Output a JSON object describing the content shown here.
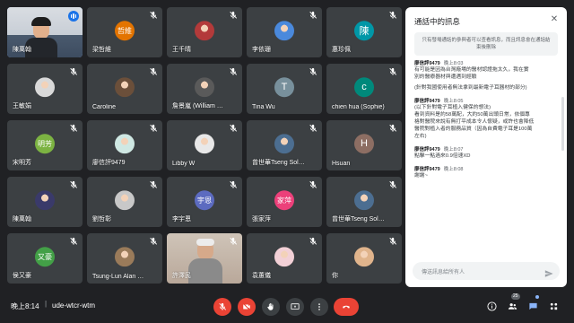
{
  "participants": [
    {
      "name": "陳萬翰",
      "kind": "video",
      "active": true
    },
    {
      "name": "梁哲維",
      "kind": "letter",
      "initial": "哲維",
      "color": "#e37400"
    },
    {
      "name": "王千晴",
      "kind": "photo",
      "color": "#b33a3a"
    },
    {
      "name": "李依珊",
      "kind": "photo",
      "color": "#4a89dc"
    },
    {
      "name": "惠珍佩",
      "kind": "letter",
      "initial": "陳",
      "color": "#0097a7"
    },
    {
      "name": "王敏娟",
      "kind": "photo",
      "color": "#d9d9d9"
    },
    {
      "name": "Caroline",
      "kind": "photo",
      "color": "#6b4f3a"
    },
    {
      "name": "詹景嵐 (William C...",
      "kind": "photo",
      "color": "#5a5a5a"
    },
    {
      "name": "Tina Wu",
      "kind": "letter",
      "initial": "T",
      "color": "#78909c"
    },
    {
      "name": "chien hua (Sophie)",
      "kind": "letter",
      "initial": "c",
      "color": "#00897b"
    },
    {
      "name": "宋明芳",
      "kind": "letter",
      "initial": "明芳",
      "color": "#7cb342"
    },
    {
      "name": "廖信評9479",
      "kind": "photo",
      "color": "#cfe8e3"
    },
    {
      "name": "Libby W",
      "kind": "photo",
      "color": "#e8e8e8"
    },
    {
      "name": "曾世華Tseng Solo...",
      "kind": "photo",
      "color": "#4c6e91"
    },
    {
      "name": "Hsuan",
      "kind": "letter",
      "initial": "H",
      "color": "#8d6e63"
    },
    {
      "name": "陳萬翰",
      "kind": "photo",
      "color": "#3a3a6a"
    },
    {
      "name": "劉哲彰",
      "kind": "photo",
      "color": "#c8c8c8"
    },
    {
      "name": "李宇恩",
      "kind": "letter",
      "initial": "宇恩",
      "color": "#5c6bc0"
    },
    {
      "name": "張家萍",
      "kind": "letter",
      "initial": "家萍",
      "color": "#ec407a"
    },
    {
      "name": "曾世華Tseng Solo...",
      "kind": "photo",
      "color": "#4c6e91"
    },
    {
      "name": "侯又豪",
      "kind": "letter",
      "initial": "又豪",
      "color": "#43a047"
    },
    {
      "name": "Tsung-Lun Alan W...",
      "kind": "photo",
      "color": "#9a7b5a"
    },
    {
      "name": "許澤民",
      "kind": "video",
      "color": "#b9a89a"
    },
    {
      "name": "袁蕙儀",
      "kind": "photo",
      "color": "#f2d0d6"
    },
    {
      "name": "你",
      "kind": "photo",
      "color": "#e0b48c"
    }
  ],
  "chat": {
    "title": "通話中的訊息",
    "notice": "只有發場通話的參與者可以查看訊息，而且訊息會在通話結束後刪除",
    "messages": [
      {
        "sender": "廖信評9479",
        "time": "晚上8:03",
        "lines": [
          "有可能是因為台灣廠場的醫材認證拖太久，我在實",
          "別的醫療器材與遭遇到經驗"
        ],
        "extra": [
          "(針對我國使用者無法拿到最新電子耳器材的部分)"
        ]
      },
      {
        "sender": "廖信評9479",
        "time": "晚上8:05",
        "lines": [
          "(以下針對電子耳植入健保的想法)",
          "看到資料是約58萬配，大約50萬出頭日常，依個專",
          "格對醫院來說有無打平成本令人懷疑，或許也會降低",
          "醫院對植入者的服務品質（因為自費電子耳是100萬",
          "左右)"
        ],
        "extra": []
      },
      {
        "sender": "廖信評9479",
        "time": "晚上8:07",
        "lines": [
          "點擊一點過來0.9倍速XD"
        ],
        "extra": []
      },
      {
        "sender": "廖信評9479",
        "time": "晚上8:08",
        "lines": [
          "謝謝~"
        ],
        "extra": []
      }
    ],
    "composer_placeholder": "傳送訊息給所有人"
  },
  "bottom": {
    "time": "晚上8:14",
    "separator": "|",
    "meeting_code": "ude-wtcr-wtm",
    "participant_count": "25"
  },
  "colors": {
    "background": "#202124",
    "tile": "#3c4043",
    "end_call": "#ea4335",
    "accent": "#8ab4f8"
  },
  "icons": {
    "tile_mic": "mic-off-icon",
    "send": "send-icon"
  }
}
